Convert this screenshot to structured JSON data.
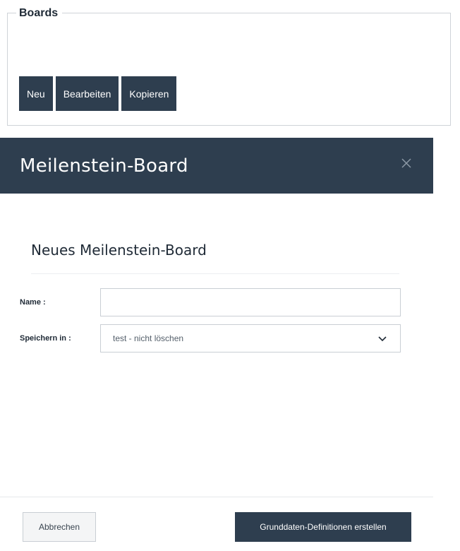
{
  "boards": {
    "legend": "Boards",
    "buttons": {
      "new": "Neu",
      "edit": "Bearbeiten",
      "copy": "Kopieren"
    }
  },
  "dialog": {
    "title": "Meilenstein-Board",
    "close_icon": "close-icon",
    "section_title": "Neues Meilenstein-Board",
    "form": {
      "name_label": "Name :",
      "name_value": "",
      "save_in_label": "Speichern in :",
      "save_in_value": "test - nicht löschen"
    },
    "footer": {
      "cancel": "Abbrechen",
      "submit": "Grunddaten-Definitionen erstellen"
    }
  },
  "colors": {
    "header_bg": "#2e3e4f",
    "button_dark": "#2e3e4f",
    "border": "#cfd3d8"
  }
}
